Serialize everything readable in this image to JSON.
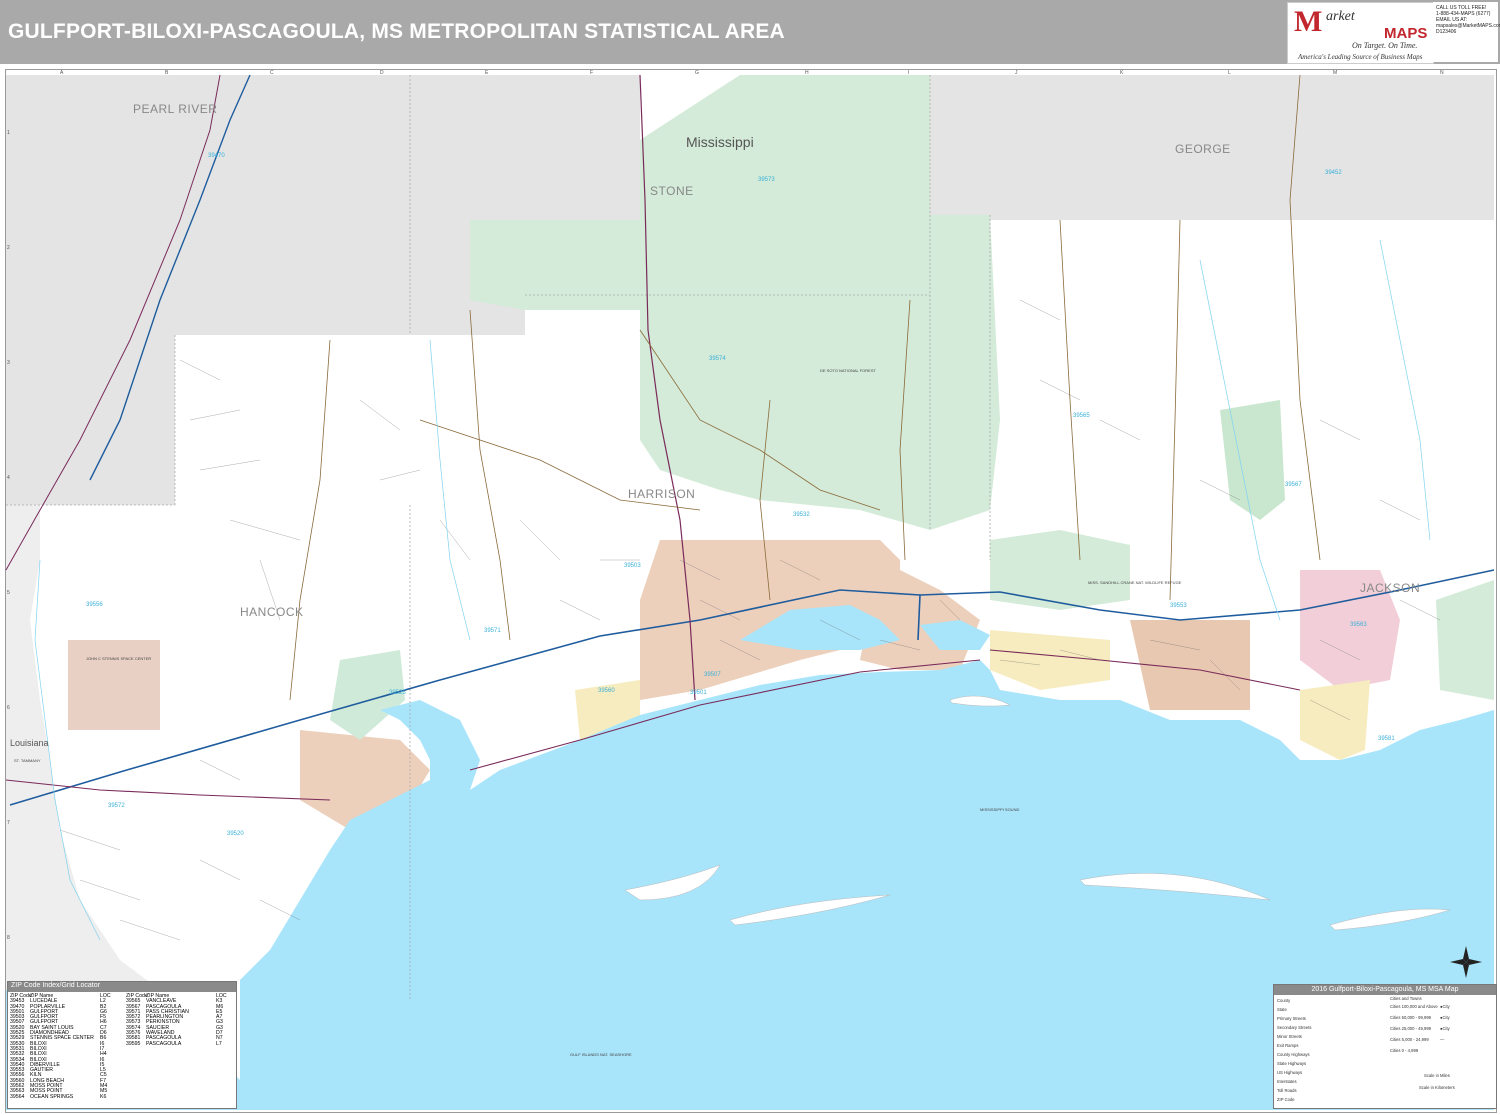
{
  "title": "GULFPORT-BILOXI-PASCAGOULA, MS METROPOLITAN STATISTICAL AREA",
  "logo": {
    "mark": "M",
    "word1": "arket",
    "word2": "MAPS",
    "tagline1": "On Target. On Time.",
    "tagline2": "America's Leading Source of Business Maps"
  },
  "contact": [
    "CALL US TOLL FREE!",
    "1-888-434-MAPS (6277)",
    "EMAIL US AT:",
    "mapsales@MarketMAPS.com",
    "D123406"
  ],
  "grid_columns": [
    "A",
    "B",
    "C",
    "D",
    "E",
    "F",
    "G",
    "H",
    "I",
    "J",
    "K",
    "L",
    "M",
    "N"
  ],
  "grid_rows": [
    "1",
    "2",
    "3",
    "4",
    "5",
    "6",
    "7",
    "8",
    "9"
  ],
  "labels": {
    "counties": [
      "PEARL RIVER",
      "STONE",
      "GEORGE",
      "HARRISON",
      "HANCOCK",
      "JACKSON"
    ],
    "states": [
      "Mississippi",
      "Louisiana"
    ],
    "zips": [
      "39470",
      "39573",
      "39452",
      "39574",
      "39565",
      "39532",
      "39503",
      "39560",
      "39571",
      "39520",
      "39525",
      "39507",
      "39501",
      "39553",
      "39563",
      "39581",
      "39567",
      "39572",
      "39556"
    ],
    "features": [
      "DE SOTO NATIONAL FOREST",
      "MISSISSIPPI SOUND",
      "MISS. SANDHILL CRANE NAT. WILDLIFE REFUGE",
      "JOHN C STENNIS SPACE CENTER",
      "GULF ISLANDS NAT. SEASHORE",
      "ST. TAMMANY"
    ]
  },
  "zip_index": {
    "title": "ZIP Code Index/Grid Locator",
    "headers": [
      "ZIP Code",
      "ZIP Name",
      "LOC"
    ],
    "col1": [
      [
        "39453",
        "LUCEDALE",
        "L2"
      ],
      [
        "39470",
        "POPLARVILLE",
        "B2"
      ],
      [
        "39501",
        "GULFPORT",
        "G6"
      ],
      [
        "39503",
        "GULFPORT",
        "F5"
      ],
      [
        "39507",
        "GULFPORT",
        "H6"
      ],
      [
        "39520",
        "BAY SAINT LOUIS",
        "C7"
      ],
      [
        "39525",
        "DIAMONDHEAD",
        "D6"
      ],
      [
        "39529",
        "STENNIS SPACE CENTER",
        "B6"
      ],
      [
        "39530",
        "BILOXI",
        "I6"
      ],
      [
        "39531",
        "BILOXI",
        "I7"
      ],
      [
        "39532",
        "BILOXI",
        "H4"
      ],
      [
        "39534",
        "BILOXI",
        "I6"
      ],
      [
        "39540",
        "DIBERVILLE",
        "I5"
      ],
      [
        "39553",
        "GAUTIER",
        "L5"
      ],
      [
        "39556",
        "KILN",
        "C5"
      ],
      [
        "39560",
        "LONG BEACH",
        "F7"
      ],
      [
        "39562",
        "MOSS POINT",
        "M4"
      ],
      [
        "39563",
        "MOSS POINT",
        "M5"
      ],
      [
        "39564",
        "OCEAN SPRINGS",
        "K6"
      ]
    ],
    "col2": [
      [
        "39565",
        "VANCLEAVE",
        "K3"
      ],
      [
        "39567",
        "PASCAGOULA",
        "M6"
      ],
      [
        "39571",
        "PASS CHRISTIAN",
        "E5"
      ],
      [
        "39572",
        "PEARLINGTON",
        "A7"
      ],
      [
        "39573",
        "PERKINSTON",
        "G3"
      ],
      [
        "39574",
        "SAUCIER",
        "G3"
      ],
      [
        "39576",
        "WAVELAND",
        "D7"
      ],
      [
        "39581",
        "PASCAGOULA",
        "N7"
      ],
      [
        "39595",
        "PASCAGOULA",
        "L7"
      ]
    ]
  },
  "legend": {
    "title": "2016 Gulfport-Biloxi-Pascagoula, MS MSA Map",
    "items": [
      "County",
      "State",
      "Primary Streets",
      "Secondary Streets",
      "Minor Streets",
      "Exit Ramps",
      "County Highways",
      "State Highways",
      "US Highways",
      "Interstates",
      "Toll Roads",
      "ZIP Code"
    ],
    "cities_title": "Cities and Towns",
    "cities": [
      "Cities 100,000 and Above",
      "Cities 50,000 - 99,999",
      "Cities 25,000 - 49,999",
      "Cities 5,000 - 24,999",
      "Cities 0 - 4,999"
    ],
    "city_labels": [
      "●City",
      "●City",
      "●City",
      "—",
      ""
    ],
    "scale": [
      "Scale in Miles",
      "Scale in Kilometers"
    ]
  },
  "colors": {
    "header": "#a9a9a9",
    "water": "#a8e4fa",
    "forest": "#cfe8d5",
    "outside_county": "#e6e6e6",
    "urban_orange": "#e8c8b0",
    "urban_pink": "#f2cfd8",
    "urban_yellow": "#f6ecbf",
    "interstate": "#1f5c9e",
    "us_highway": "#7a2a5a"
  }
}
